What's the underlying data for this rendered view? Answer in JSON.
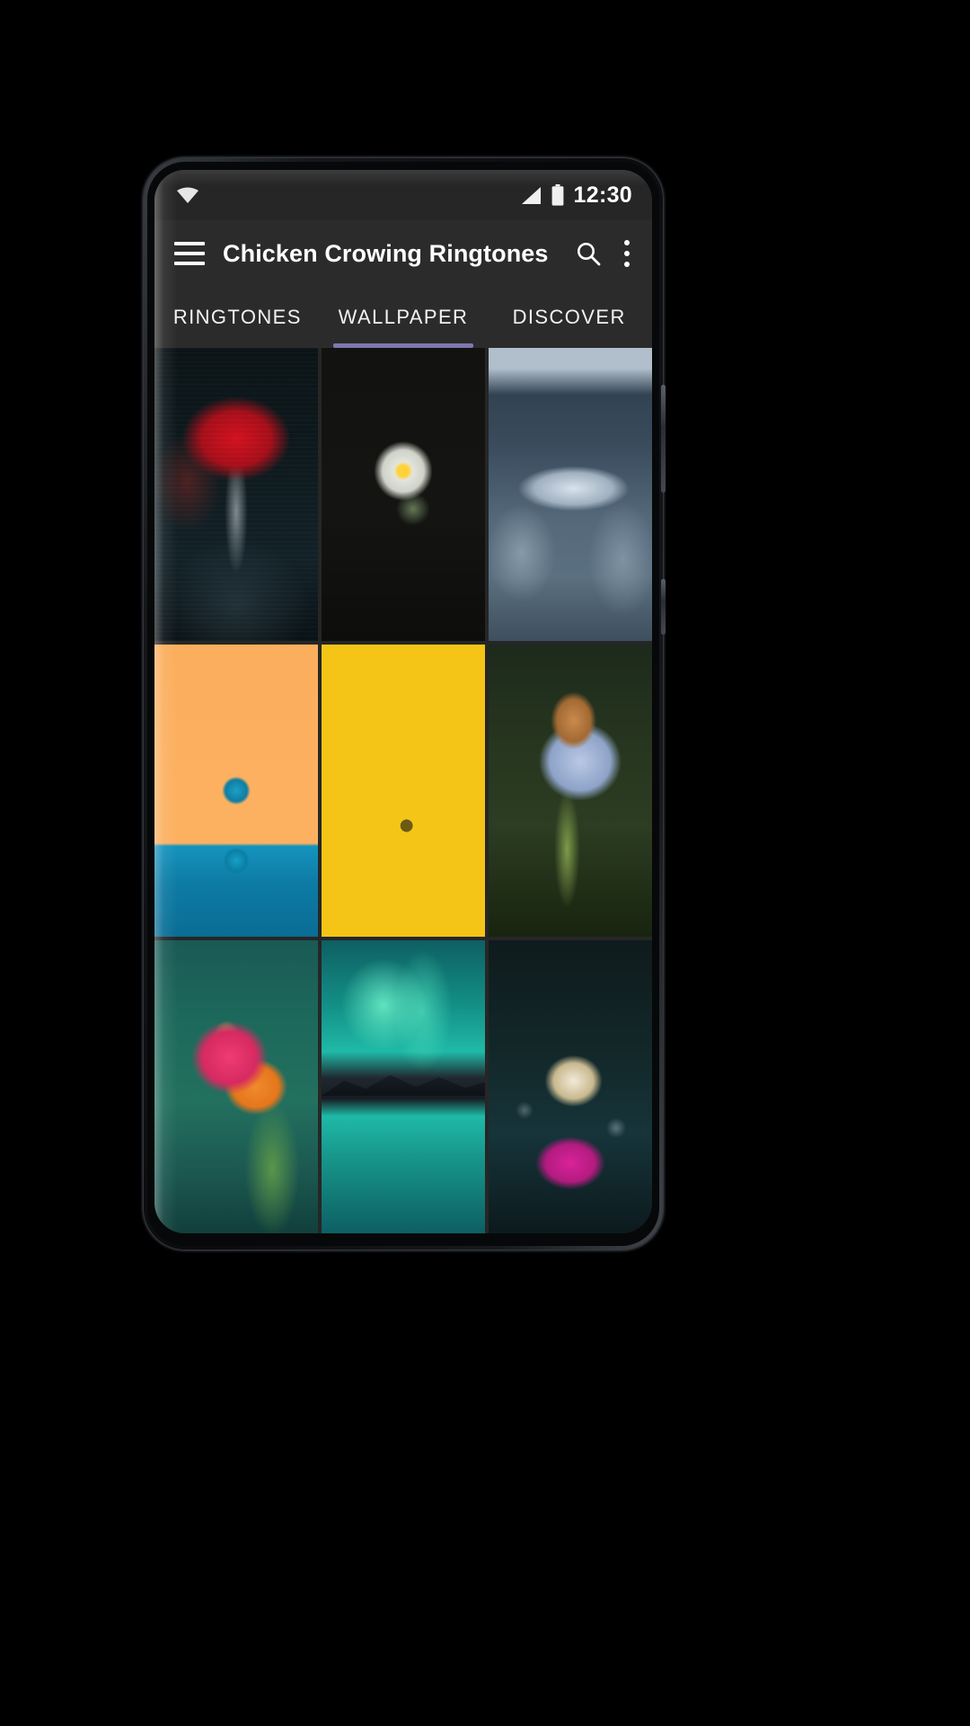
{
  "theme": {
    "accent": "#7e78b0",
    "appbar_bg": "#2b2b2b",
    "statusbar_bg": "#262626",
    "screen_bg": "#262626",
    "text": "#ffffff"
  },
  "statusbar": {
    "wifi_icon": "wifi-icon",
    "signal_icon": "signal-icon",
    "battery_icon": "battery-icon",
    "time": "12:30"
  },
  "appbar": {
    "menu_icon": "hamburger-menu-icon",
    "title": "Chicken Crowing  Ringtones",
    "search_icon": "search-icon",
    "overflow_icon": "overflow-menu-icon"
  },
  "tabs": {
    "items": [
      {
        "label": "RINGTONES",
        "active": false
      },
      {
        "label": "WALLPAPER",
        "active": true
      },
      {
        "label": "DISCOVER",
        "active": false
      }
    ]
  },
  "wallpapers": {
    "items": [
      {
        "name": "red-umbrella-rain",
        "art": "art-umbrella"
      },
      {
        "name": "white-flower-dark",
        "art": "art-whiteflower"
      },
      {
        "name": "snowy-winter-bench",
        "art": "art-snow"
      },
      {
        "name": "water-drop-orange",
        "art": "art-waterdrop"
      },
      {
        "name": "sunflower-field",
        "art": "art-sunflower"
      },
      {
        "name": "agapanthus-bud",
        "art": "art-agapanthus"
      },
      {
        "name": "pink-orange-lily",
        "art": "art-lily"
      },
      {
        "name": "aurora-mountain-lake",
        "art": "art-aurora"
      },
      {
        "name": "butterfly-pink-flower",
        "art": "art-butterfly"
      }
    ]
  }
}
